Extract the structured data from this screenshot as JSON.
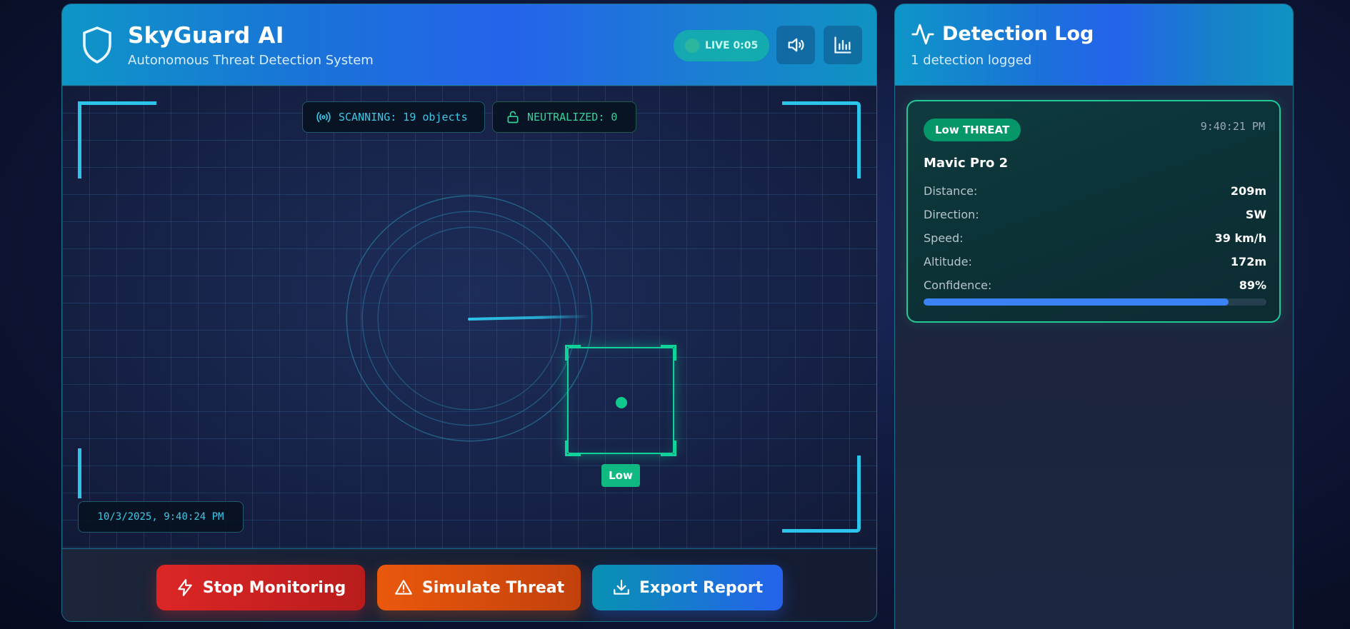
{
  "header": {
    "title": "SkyGuard AI",
    "subtitle": "Autonomous Threat Detection System",
    "live_label": "LIVE 0:05"
  },
  "viewport": {
    "scanning_label": "SCANNING: 19 objects",
    "neutralized_label": "NEUTRALIZED: 0",
    "target_label": "Low",
    "timestamp": "10/3/2025, 9:40:24 PM"
  },
  "controls": {
    "stop_label": "Stop Monitoring",
    "simulate_label": "Simulate Threat",
    "export_label": "Export Report"
  },
  "log": {
    "title": "Detection Log",
    "count_text": "1 detection logged",
    "entries": [
      {
        "threat_label": "Low THREAT",
        "time": "9:40:21 PM",
        "name": "Mavic Pro 2",
        "stats": [
          {
            "label": "Distance:",
            "value": "209m"
          },
          {
            "label": "Direction:",
            "value": "SW"
          },
          {
            "label": "Speed:",
            "value": "39 km/h"
          },
          {
            "label": "Altitude:",
            "value": "172m"
          },
          {
            "label": "Confidence:",
            "value": "89%"
          }
        ],
        "confidence_fraction": 0.89
      }
    ]
  },
  "colors": {
    "accent_cyan": "#2cc4ea",
    "threat_low": "#10b981",
    "stop": "#dc2626",
    "simulate": "#ea580c",
    "export": "#2563eb"
  },
  "icons": {
    "brand": "shield-icon",
    "sound": "speaker-icon",
    "stats": "bar-chart-icon",
    "log": "pulse-icon",
    "scan": "broadcast-icon",
    "neutralized": "lock-icon",
    "stop": "lightning-icon",
    "simulate": "warning-icon",
    "export": "download-icon"
  }
}
